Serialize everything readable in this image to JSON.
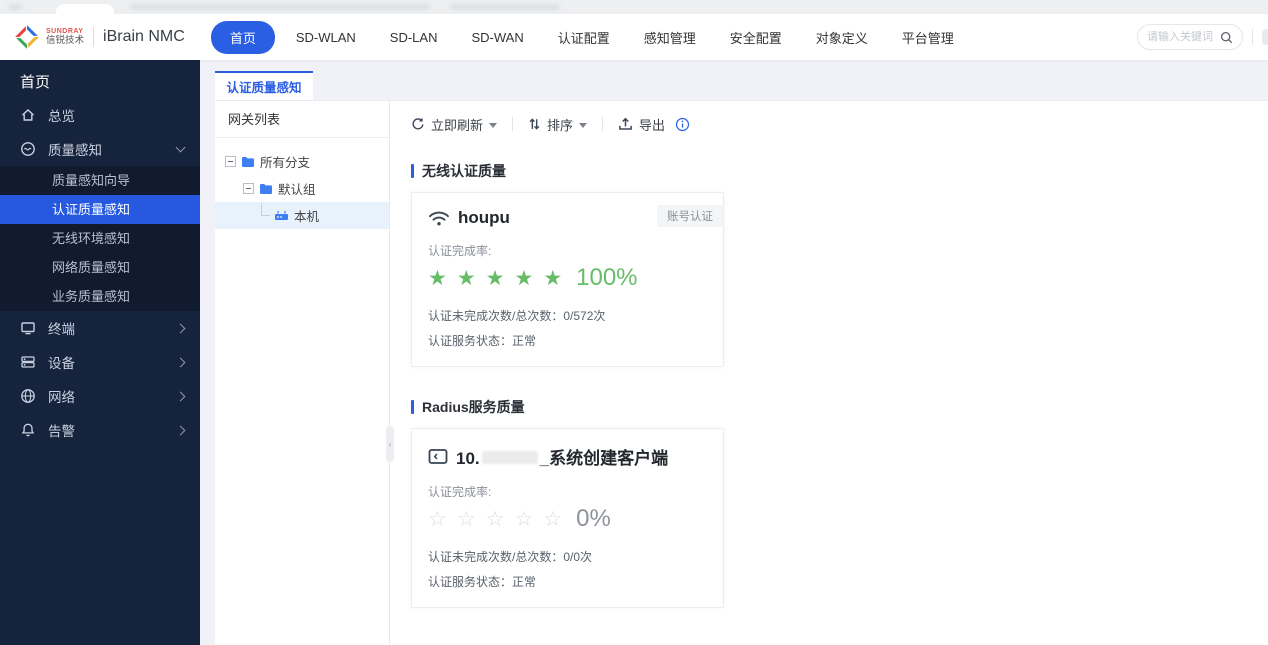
{
  "colors": {
    "primary": "#2B5FE3",
    "success": "#67BD67",
    "sidebar_bg": "#16233C",
    "sidebar_submenu_bg": "#111B2F",
    "tree_selected_bg": "#E7F2FD"
  },
  "icons": {
    "star_filled": "★",
    "star_empty": "☆",
    "collapse_arrow": "‹"
  },
  "header": {
    "brand": {
      "logo_line1": "SUNDRAY",
      "logo_line2": "信锐技术",
      "product": "iBrain NMC"
    },
    "nav": [
      {
        "label": "首页",
        "active": true
      },
      {
        "label": "SD-WLAN"
      },
      {
        "label": "SD-LAN"
      },
      {
        "label": "SD-WAN"
      },
      {
        "label": "认证配置"
      },
      {
        "label": "感知管理"
      },
      {
        "label": "安全配置"
      },
      {
        "label": "对象定义"
      },
      {
        "label": "平台管理"
      }
    ],
    "search": {
      "placeholder": "请输入关键词"
    }
  },
  "sidebar": {
    "title": "首页",
    "overview": "总览",
    "quality_group": {
      "label": "质量感知",
      "children": [
        {
          "label": "质量感知向导"
        },
        {
          "label": "认证质量感知",
          "active": true
        },
        {
          "label": "无线环境感知"
        },
        {
          "label": "网络质量感知"
        },
        {
          "label": "业务质量感知"
        }
      ]
    },
    "groups": [
      {
        "label": "终端"
      },
      {
        "label": "设备"
      },
      {
        "label": "网络"
      },
      {
        "label": "告警"
      }
    ]
  },
  "main": {
    "tab": "认证质量感知",
    "gateway_panel": {
      "title": "网关列表",
      "tree": {
        "root": "所有分支",
        "group": "默认组",
        "leaf": "本机"
      }
    },
    "toolbar": {
      "refresh": "立即刷新",
      "sort": "排序",
      "export": "导出"
    },
    "wireless_section": {
      "title": "无线认证质量",
      "card": {
        "name": "houpu",
        "tag": "账号认证",
        "rate_label": "认证完成率:",
        "rate": "100%",
        "stars_filled": 5,
        "stats": "认证未完成次数/总次数：0/572次",
        "status": "认证服务状态：正常"
      }
    },
    "radius_section": {
      "title": "Radius服务质量",
      "card": {
        "name_prefix": "10.",
        "name_suffix": "_系统创建客户端",
        "rate_label": "认证完成率:",
        "rate": "0%",
        "stars_filled": 0,
        "stats": "认证未完成次数/总次数：0/0次",
        "status": "认证服务状态：正常"
      }
    }
  }
}
